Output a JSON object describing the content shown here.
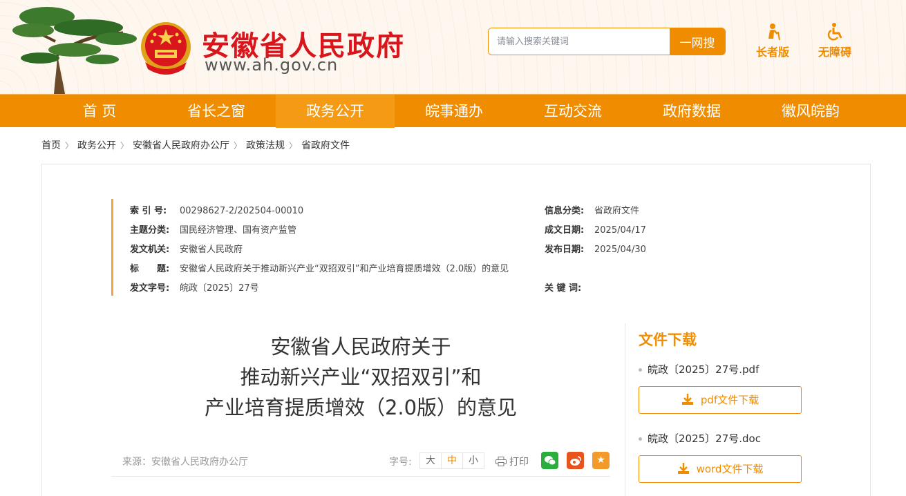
{
  "header": {
    "site_title": "安徽省人民政府",
    "site_url": "www.ah.gov.cn",
    "search_placeholder": "请输入搜索关键词",
    "search_button": "一网搜",
    "tools": [
      {
        "label": "长者版",
        "icon": "elderly-icon"
      },
      {
        "label": "无障碍",
        "icon": "wheelchair-icon"
      }
    ]
  },
  "nav": {
    "items": [
      "首 页",
      "省长之窗",
      "政务公开",
      "皖事通办",
      "互动交流",
      "政府数据",
      "徽风皖韵"
    ],
    "active_index": 2
  },
  "breadcrumb": [
    "首页",
    "政务公开",
    "安徽省人民政府办公厅",
    "政策法规",
    "省政府文件"
  ],
  "meta": {
    "index_label": "索 引 号:",
    "index_value": "00298627-2/202504-00010",
    "info_class_label": "信息分类:",
    "info_class_value": "省政府文件",
    "topic_label": "主题分类:",
    "topic_value": "国民经济管理、国有资产监管",
    "created_label": "成文日期:",
    "created_value": "2025/04/17",
    "issuer_label": "发文机关:",
    "issuer_value": "安徽省人民政府",
    "published_label": "发布日期:",
    "published_value": "2025/04/30",
    "title_label": "标　　题:",
    "title_value": "安徽省人民政府关于推动新兴产业“双招双引”和产业培育提质增效（2.0版）的意见",
    "docno_label": "发文字号:",
    "docno_value": "皖政〔2025〕27号",
    "keywords_label": "关 键 词:",
    "keywords_value": ""
  },
  "article": {
    "title_lines": [
      "安徽省人民政府关于",
      "推动新兴产业“双招双引”和",
      "产业培育提质增效（2.0版）的意见"
    ],
    "source": "来源：安徽省人民政府办公厅",
    "font_size_label": "字号:",
    "font_sizes": [
      "大",
      "中",
      "小"
    ],
    "font_size_selected": "中",
    "print_label": "打印"
  },
  "share": [
    {
      "name": "wechat",
      "color": "#2aae3e"
    },
    {
      "name": "weibo",
      "color": "#e8541e"
    },
    {
      "name": "favorite",
      "color": "#f29a2a"
    }
  ],
  "download": {
    "title": "文件下载",
    "files": [
      {
        "name": "皖政〔2025〕27号.pdf",
        "button": "pdf文件下载"
      },
      {
        "name": "皖政〔2025〕27号.doc",
        "button": "word文件下载"
      }
    ]
  },
  "colors": {
    "brand_orange": "#f08c00",
    "brand_red": "#d8161c"
  }
}
